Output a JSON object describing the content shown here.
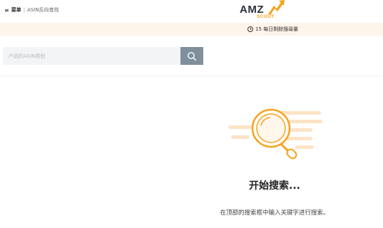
{
  "header": {
    "menu_icon": "hamburger-icon",
    "menu_label": "菜单",
    "separator": "|",
    "breadcrumb": "ASIN反向查找",
    "logo": {
      "amz": "AMZ",
      "scout": "SCOUT",
      "brand_color": "#f7a21b"
    }
  },
  "notice": {
    "icon": "clock-icon",
    "text": "15 每日剩餘搜尋量",
    "background": "#fdf4ea"
  },
  "search": {
    "placeholder": "产品的ASIN类别",
    "value": "",
    "button_icon": "search-icon",
    "button_color": "#7f8f9c"
  },
  "empty_state": {
    "illustration": "magnifier-illustration",
    "title": "开始搜索...",
    "description": "在顶部的搜索框中输入关键字进行搜索。"
  }
}
